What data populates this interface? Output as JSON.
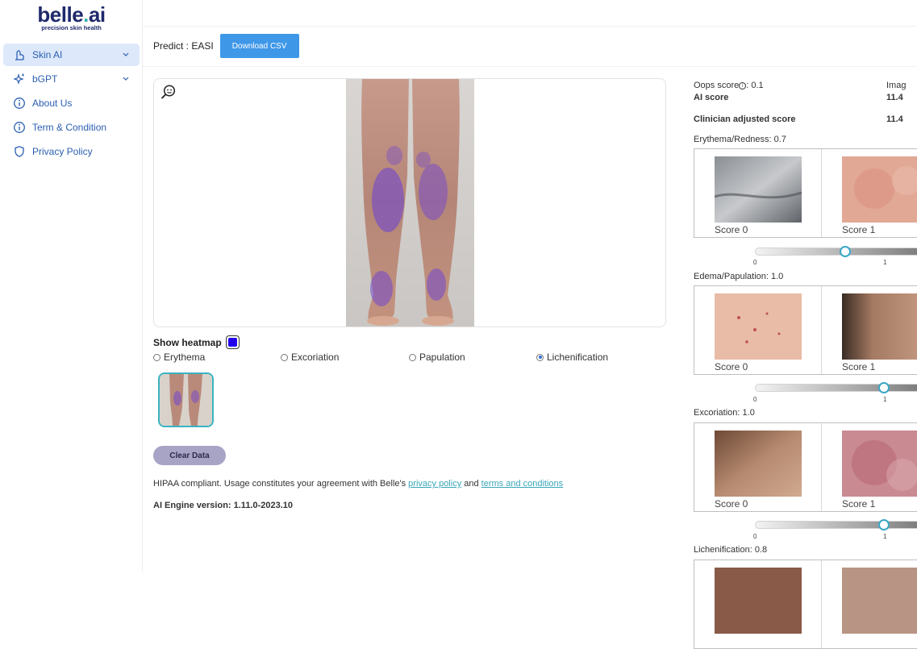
{
  "brand": {
    "name_part1": "belle",
    "name_dot": ".",
    "name_part2": "ai",
    "tagline": "precision skin health"
  },
  "sidebar": {
    "items": [
      {
        "label": "Skin AI",
        "icon": "skin-ai-icon",
        "expandable": true,
        "active": true
      },
      {
        "label": "bGPT",
        "icon": "sparkle-icon",
        "expandable": true,
        "active": false
      },
      {
        "label": "About Us",
        "icon": "info-circle-icon",
        "expandable": false,
        "active": false
      },
      {
        "label": "Term & Condition",
        "icon": "info-circle-icon",
        "expandable": false,
        "active": false
      },
      {
        "label": "Privacy Policy",
        "icon": "shield-icon",
        "expandable": false,
        "active": false
      }
    ]
  },
  "header": {
    "predict_label": "Predict : EASI",
    "download_label": "Download CSV"
  },
  "viewer": {
    "zoom_icon": "zoom-face-icon",
    "image_alt": "Posterior view of lower legs with heatmap"
  },
  "heatmap": {
    "label": "Show heatmap",
    "color": "#2200ee",
    "options": [
      {
        "label": "Erythema",
        "selected": false
      },
      {
        "label": "Excoriation",
        "selected": false
      },
      {
        "label": "Papulation",
        "selected": false
      },
      {
        "label": "Lichenification",
        "selected": true
      }
    ]
  },
  "actions": {
    "clear_label": "Clear Data"
  },
  "footer": {
    "hipaa_prefix": "HIPAA compliant. Usage constitutes your agreement with Belle's ",
    "privacy_link": "privacy policy",
    "and_text": " and ",
    "terms_link": "terms and conditions",
    "engine_version": "AI Engine version: 1.11.0-2023.10"
  },
  "scores": {
    "oops_label": "Oops score",
    "oops_value": ": 0.1",
    "ai_score_label": "AI score",
    "ai_score_value": "11.4",
    "clinician_label": "Clinician adjusted score",
    "clinician_value": "11.4",
    "image_label": "Imag"
  },
  "sections": [
    {
      "title": "Erythema/Redness: 0.7",
      "value": 0.7,
      "cap0": "Score 0",
      "cap1": "Score 1",
      "tick0": "0",
      "tick1": "1"
    },
    {
      "title": "Edema/Papulation: 1.0",
      "value": 1.0,
      "cap0": "Score 0",
      "cap1": "Score 1",
      "tick0": "0",
      "tick1": "1"
    },
    {
      "title": "Excoriation: 1.0",
      "value": 1.0,
      "cap0": "Score 0",
      "cap1": "Score 1",
      "tick0": "0",
      "tick1": "1"
    },
    {
      "title": "Lichenification: 0.8",
      "value": 0.8
    }
  ],
  "colors": {
    "accent": "#3f97e8",
    "teal": "#3ab3c0",
    "brand": "#1f2a6b",
    "nav_active": "#dde8fa"
  }
}
